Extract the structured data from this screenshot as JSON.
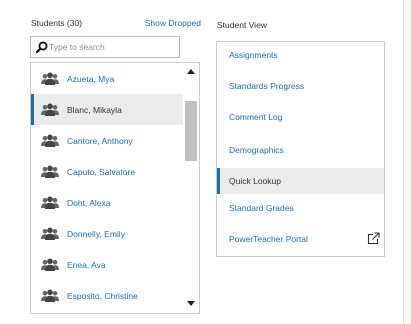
{
  "students_panel": {
    "title": "Students (30)",
    "show_dropped_label": "Show Dropped",
    "search": {
      "placeholder": "Type to search",
      "value": ""
    },
    "students": [
      {
        "name": "Azueta, Mya",
        "icon": "student-icon",
        "selected": false
      },
      {
        "name": "Blanc, Mikayla",
        "icon": "student-icon",
        "selected": true
      },
      {
        "name": "Cantore, Anthony",
        "icon": "student-icon",
        "selected": false
      },
      {
        "name": "Caputo, Salvatore",
        "icon": "student-icon",
        "selected": false
      },
      {
        "name": "Doht, Alexa",
        "icon": "student-icon",
        "selected": false
      },
      {
        "name": "Donnelly, Emily",
        "icon": "student-icon",
        "selected": false
      },
      {
        "name": "Enea, Ava",
        "icon": "student-icon",
        "selected": false
      },
      {
        "name": "Esposito, Christine",
        "icon": "student-icon",
        "selected": false
      }
    ]
  },
  "student_view": {
    "title": "Student View",
    "items": [
      {
        "label": "Assignments",
        "selected": false
      },
      {
        "label": "Standards Progress",
        "selected": false
      },
      {
        "label": "Comment Log",
        "selected": false
      },
      {
        "label": "Demographics",
        "selected": false
      },
      {
        "label": "Quick Lookup",
        "selected": true
      },
      {
        "label": "Standard Grades",
        "selected": false
      },
      {
        "label": "PowerTeacher Portal",
        "selected": false,
        "icon": "external-link-icon"
      }
    ]
  },
  "colors": {
    "link": "#1f6fa8",
    "selected_bg": "#ebebeb",
    "selected_bar": "#1f6fa8",
    "icon": "#555555"
  }
}
